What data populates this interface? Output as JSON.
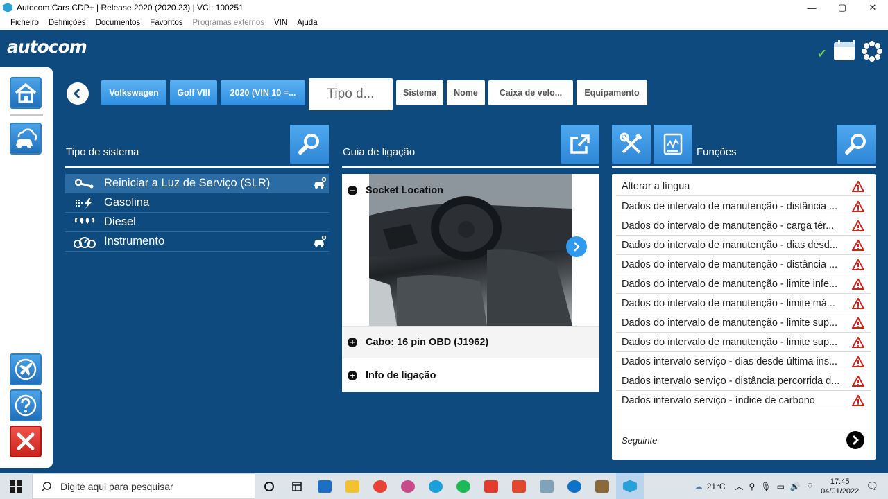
{
  "window": {
    "title": "Autocom Cars CDP+ |  Release 2020 (2020.23)  |  VCI: 100251",
    "controls": [
      "—",
      "▢",
      "✕"
    ]
  },
  "menu": {
    "items": [
      "Ficheiro",
      "Definições",
      "Documentos",
      "Favoritos",
      "Programas externos",
      "VIN",
      "Ajuda"
    ],
    "disabled": [
      "Programas externos"
    ]
  },
  "brand": {
    "logo": "autocom"
  },
  "breadcrumbs": {
    "make": "Volkswagen",
    "model": "Golf VIII",
    "year": "2020 (VIN 10 =...",
    "type": "Tipo d...",
    "system": "Sistema",
    "name": "Nome",
    "gearbox": "Caixa de velo...",
    "equipment": "Equipamento"
  },
  "system_panel": {
    "title": "Tipo de sistema",
    "items": [
      {
        "label": "Reiniciar a Luz de Serviço (SLR)",
        "icon": "wrench-icon",
        "selected": true,
        "has_car_icon": true
      },
      {
        "label": "Gasolina",
        "icon": "fuel-spark-icon",
        "selected": false,
        "has_car_icon": false
      },
      {
        "label": "Diesel",
        "icon": "glow-plug-icon",
        "selected": false,
        "has_car_icon": false
      },
      {
        "label": "Instrumento",
        "icon": "gauge-icon",
        "selected": false,
        "has_car_icon": true
      }
    ]
  },
  "guide_panel": {
    "title": "Guia de ligação",
    "socket_label": "Socket Location",
    "cable_label": "Cabo: 16 pin OBD (J1962)",
    "info_label": "Info de ligação"
  },
  "functions_panel": {
    "title": "Funções",
    "items": [
      "Alterar a língua",
      "Dados de intervalo de manutenção - distância ...",
      "Dados do intervalo de manutenção - carga tér...",
      "Dados do intervalo de manutenção - dias desd...",
      "Dados do intervalo de manutenção - distância ...",
      "Dados do intervalo de manutenção - limite infe...",
      "Dados do intervalo de manutenção - limite má...",
      "Dados do intervalo de manutenção - limite sup...",
      "Dados do intervalo de manutenção - limite sup...",
      "Dados intervalo serviço - dias desde última ins...",
      "Dados intervalo serviço - distância percorrida d...",
      "Dados intervalo serviço - índice de carbono"
    ],
    "next_label": "Seguinte"
  },
  "taskbar": {
    "search_placeholder": "Digite aqui para pesquisar",
    "weather": "21°C",
    "time": "17:45",
    "date": "04/01/2022"
  },
  "colors": {
    "app_bg": "#0f4a7f",
    "button_blue": "#2f8fe0",
    "warning_red": "#d0241b",
    "check_green": "#6fd24e"
  }
}
